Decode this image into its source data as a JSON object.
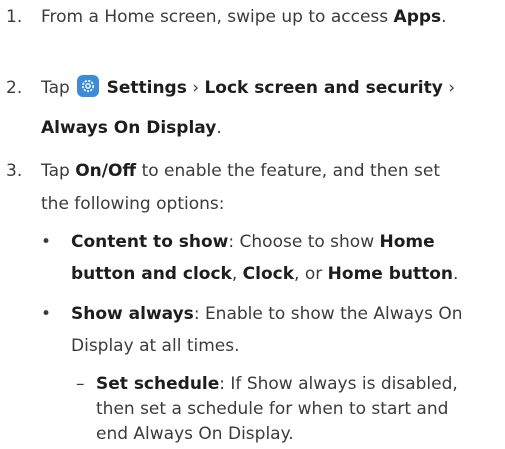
{
  "steps": [
    {
      "number": "1.",
      "lines": [
        [
          "From a Home screen, swipe up to access ",
          "Apps",
          "."
        ]
      ]
    },
    {
      "number": "2.",
      "line1_a": "Tap ",
      "line1_b": "Settings",
      "line1_c": " › ",
      "line1_d": "Lock screen and security",
      "line1_e": " ›",
      "line2_a": "Always On Display",
      "line2_b": "."
    },
    {
      "number": "3.",
      "line1_a": "Tap ",
      "line1_b": "On/Off",
      "line1_c": " to enable the feature, and then set",
      "line2": "the following options:"
    }
  ],
  "bullets": [
    {
      "line1_a": "Content to show",
      "line1_b": ": Choose to show ",
      "line1_c": "Home",
      "line2_a": "button and clock",
      "line2_b": ", ",
      "line2_c": "Clock",
      "line2_d": ", or ",
      "line2_e": "Home button",
      "line2_f": "."
    },
    {
      "line1_a": "Show always",
      "line1_b": ": Enable to show the Always On",
      "line2": "Display at all times."
    }
  ],
  "subitem": {
    "line1_a": "Set schedule",
    "line1_b": ": If Show always is disabled,",
    "line2": "then set a schedule for when to start and",
    "line3": "end Always On Display."
  },
  "icons": {
    "settings": "gear-icon"
  },
  "colors": {
    "settings_icon_bg": "#3d8bd9"
  }
}
